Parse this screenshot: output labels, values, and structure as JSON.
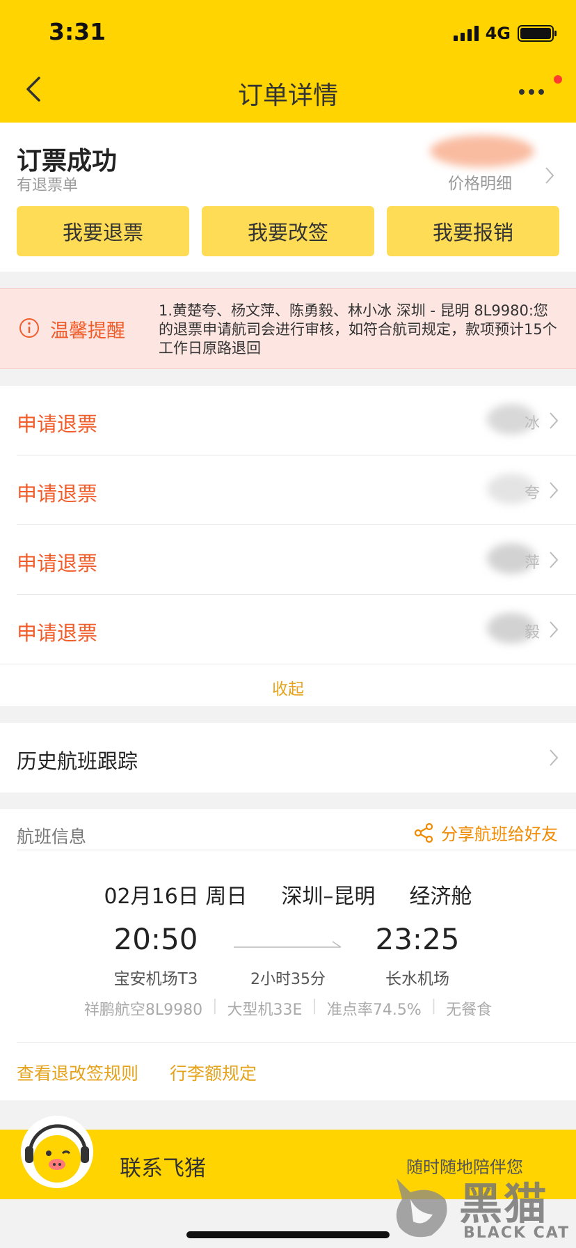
{
  "status_bar": {
    "time": "3:31",
    "network": "4G"
  },
  "nav": {
    "title": "订单详情"
  },
  "order": {
    "status": "订票成功",
    "sub_status": "有退票单",
    "price_label": "价格明细",
    "buttons": [
      "我要退票",
      "我要改签",
      "我要报销"
    ]
  },
  "reminder": {
    "label": "温馨提醒",
    "text": "1.黄楚夸、杨文萍、陈勇毅、林小冰 深圳 - 昆明 8L9980:您的退票申请航司会进行审核，如符合航司规定，款项预计15个工作日原路退回"
  },
  "refunds": [
    {
      "label": "申请退票",
      "name": "冰"
    },
    {
      "label": "申请退票",
      "name": "夸"
    },
    {
      "label": "申请退票",
      "name": "萍"
    },
    {
      "label": "申请退票",
      "name": "毅"
    }
  ],
  "collapse_label": "收起",
  "history": {
    "label": "历史航班跟踪"
  },
  "flight": {
    "section_label": "航班信息",
    "share_label": "分享航班给好友",
    "date": "02月16日 周日",
    "route": "深圳–昆明",
    "cabin": "经济舱",
    "depart_time": "20:50",
    "arrive_time": "23:25",
    "depart_airport": "宝安机场T3",
    "arrive_airport": "长水机场",
    "duration": "2小时35分",
    "details": [
      "祥鹏航空8L9980",
      "大型机33E",
      "准点率74.5%",
      "无餐食"
    ],
    "links": [
      "查看退改签规则",
      "行李额规定"
    ]
  },
  "contact": {
    "label": "联系飞猪",
    "slogan": "随时随地陪伴您"
  },
  "watermark": {
    "cn": "黑猫",
    "en": "BLACK CAT"
  },
  "colors": {
    "brand_yellow": "#ffd400",
    "button_yellow": "#ffdc55",
    "accent_orange": "#f05d2a",
    "link_gold": "#e5a31c"
  }
}
